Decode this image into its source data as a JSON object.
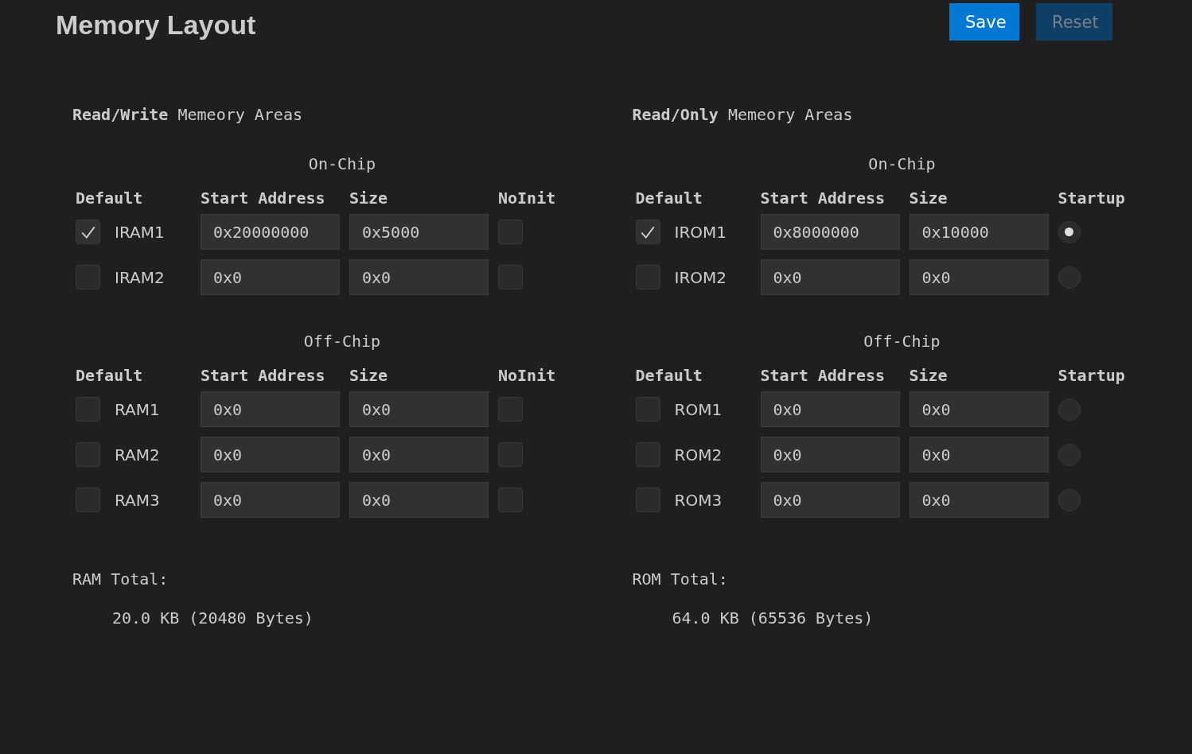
{
  "title": "Memory Layout",
  "buttons": [
    {
      "label": "Save",
      "kind": "primary",
      "disabled": false
    },
    {
      "label": "Reset",
      "kind": "secondary",
      "disabled": true
    }
  ],
  "areas": [
    {
      "heading": "**Read/Write** Memeory Areas",
      "kind": "checkbox",
      "sections": [
        {
          "title": "On-Chip",
          "headers": [
            "Default",
            "Start Address",
            "Size",
            "NoInit"
          ],
          "rows": [
            {
              "name": "IRAM1",
              "default": true,
              "start": "0x20000000",
              "size": "0x5000",
              "flag": false
            },
            {
              "name": "IRAM2",
              "default": false,
              "start": "0x0",
              "size": "0x0",
              "flag": false
            }
          ]
        },
        {
          "title": "Off-Chip",
          "headers": [
            "Default",
            "Start Address",
            "Size",
            "NoInit"
          ],
          "rows": [
            {
              "name": "RAM1",
              "default": false,
              "start": "0x0",
              "size": "0x0",
              "flag": false
            },
            {
              "name": "RAM2",
              "default": false,
              "start": "0x0",
              "size": "0x0",
              "flag": false
            },
            {
              "name": "RAM3",
              "default": false,
              "start": "0x0",
              "size": "0x0",
              "flag": false
            }
          ]
        }
      ],
      "total_label": "RAM Total:",
      "total_value": "20.0 KB (20480 Bytes)"
    },
    {
      "heading": "**Read/Only** Memeory Areas",
      "kind": "radio",
      "sections": [
        {
          "title": "On-Chip",
          "headers": [
            "Default",
            "Start Address",
            "Size",
            "Startup"
          ],
          "rows": [
            {
              "name": "IROM1",
              "default": true,
              "start": "0x8000000",
              "size": "0x10000",
              "flag": true
            },
            {
              "name": "IROM2",
              "default": false,
              "start": "0x0",
              "size": "0x0",
              "flag": false
            }
          ]
        },
        {
          "title": "Off-Chip",
          "headers": [
            "Default",
            "Start Address",
            "Size",
            "Startup"
          ],
          "rows": [
            {
              "name": "ROM1",
              "default": false,
              "start": "0x0",
              "size": "0x0",
              "flag": false
            },
            {
              "name": "ROM2",
              "default": false,
              "start": "0x0",
              "size": "0x0",
              "flag": false
            },
            {
              "name": "ROM3",
              "default": false,
              "start": "0x0",
              "size": "0x0",
              "flag": false
            }
          ]
        }
      ],
      "total_label": "ROM Total:",
      "total_value": "64.0 KB (65536 Bytes)"
    }
  ]
}
